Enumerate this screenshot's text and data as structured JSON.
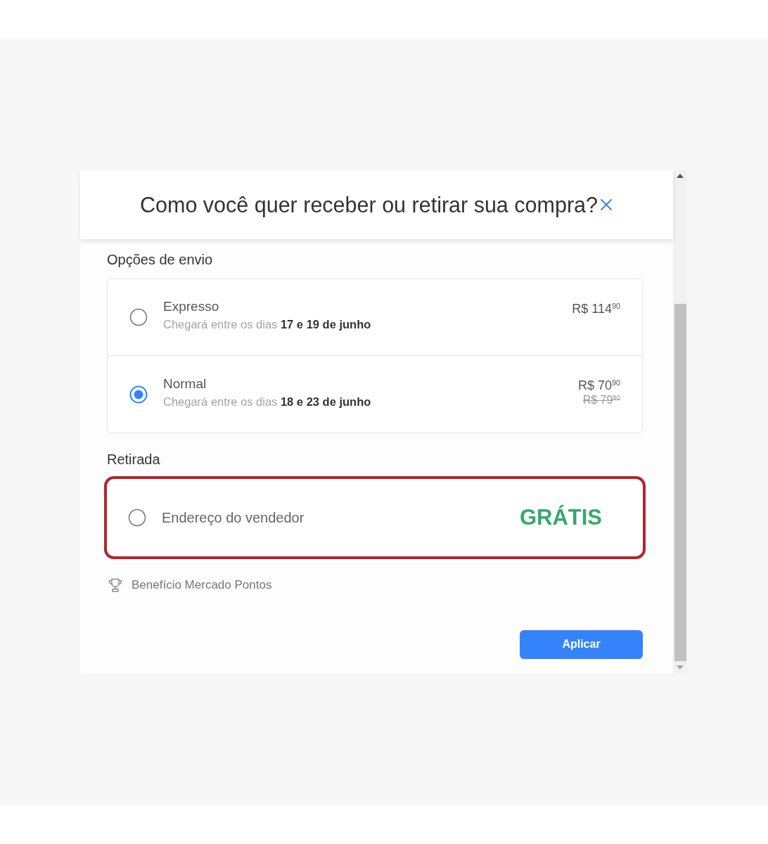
{
  "dialog": {
    "title": "Como você quer receber ou retirar sua compra?"
  },
  "sections": [
    {
      "heading": "Opções de envio",
      "options": [
        {
          "kind": "delivery",
          "name": "Expresso",
          "delivery": "Chegará entre os dias **17 e 19 de junho**",
          "price": "R$ 114$^{90}$",
          "selected": false,
          "highlighted": false
        },
        {
          "kind": "delivery",
          "name": "Normal",
          "delivery": "Chegará entre os dias **18 e 23 de junho**",
          "price": "R$ 70$^{90}$",
          "old_price": "R$ 79$^{90}$",
          "selected": true,
          "highlighted": false
        }
      ]
    },
    {
      "heading": "Retirada",
      "options": [
        {
          "kind": "pickup",
          "name": "Endereço do vendedor",
          "price": "GRÁTIS",
          "selected": false,
          "highlighted": true
        }
      ]
    }
  ],
  "benefit": {
    "label": "Benefício Mercado Pontos"
  },
  "buttons": [
    {
      "label": "Aplicar"
    }
  ]
}
